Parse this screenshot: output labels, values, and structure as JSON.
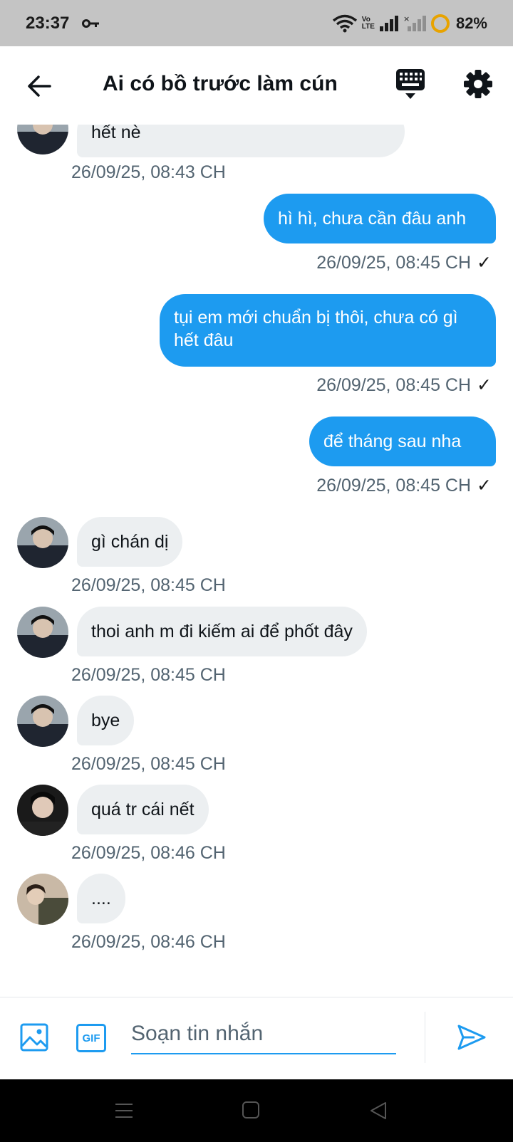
{
  "status_bar": {
    "time": "23:37",
    "volte_top": "Vo",
    "volte_bottom": "LTE",
    "battery": "82%",
    "icons": [
      "key-icon",
      "wifi-icon",
      "signal-icon",
      "signal-empty-icon",
      "battery-ring-icon"
    ]
  },
  "header": {
    "title": "Ai có bồ trước làm cún",
    "icons": [
      "back-arrow-icon",
      "keyboard-icon",
      "gear-icon"
    ]
  },
  "messages": [
    {
      "dir": "in",
      "text": "hết nè",
      "time": "26/09/25, 08:43 CH"
    },
    {
      "dir": "out",
      "text": "hì hì, chưa cần đâu anh",
      "time": "26/09/25, 08:45 CH",
      "check": "✓"
    },
    {
      "dir": "out",
      "text": "tụi em mới chuẩn bị thôi, chưa có gì hết đâu",
      "time": "26/09/25, 08:45 CH",
      "check": "✓"
    },
    {
      "dir": "out",
      "text": "để tháng sau nha",
      "time": "26/09/25, 08:45 CH",
      "check": "✓"
    },
    {
      "dir": "in",
      "text": "gì chán dị",
      "time": "26/09/25, 08:45 CH"
    },
    {
      "dir": "in",
      "text": "thoi anh m đi kiếm ai để phốt đây",
      "time": "26/09/25, 08:45 CH"
    },
    {
      "dir": "in",
      "text": "bye",
      "time": "26/09/25, 08:45 CH"
    },
    {
      "dir": "in",
      "text": "quá tr cái nết",
      "time": "26/09/25, 08:46 CH"
    },
    {
      "dir": "in",
      "text": "....",
      "time": "26/09/25, 08:46 CH"
    }
  ],
  "composer": {
    "placeholder": "Soạn tin nhắn",
    "gif_label": "GIF",
    "icons": [
      "image-icon",
      "gif-icon",
      "send-icon"
    ]
  },
  "nav_bar": {
    "icons": [
      "menu-icon",
      "home-icon",
      "back-triangle-icon"
    ]
  },
  "colors": {
    "accent": "#1d9bf0",
    "incoming_bubble": "#eceff1",
    "timestamp": "#536471",
    "status_bar": "#c4c4c4",
    "nav_bar": "#000000"
  }
}
